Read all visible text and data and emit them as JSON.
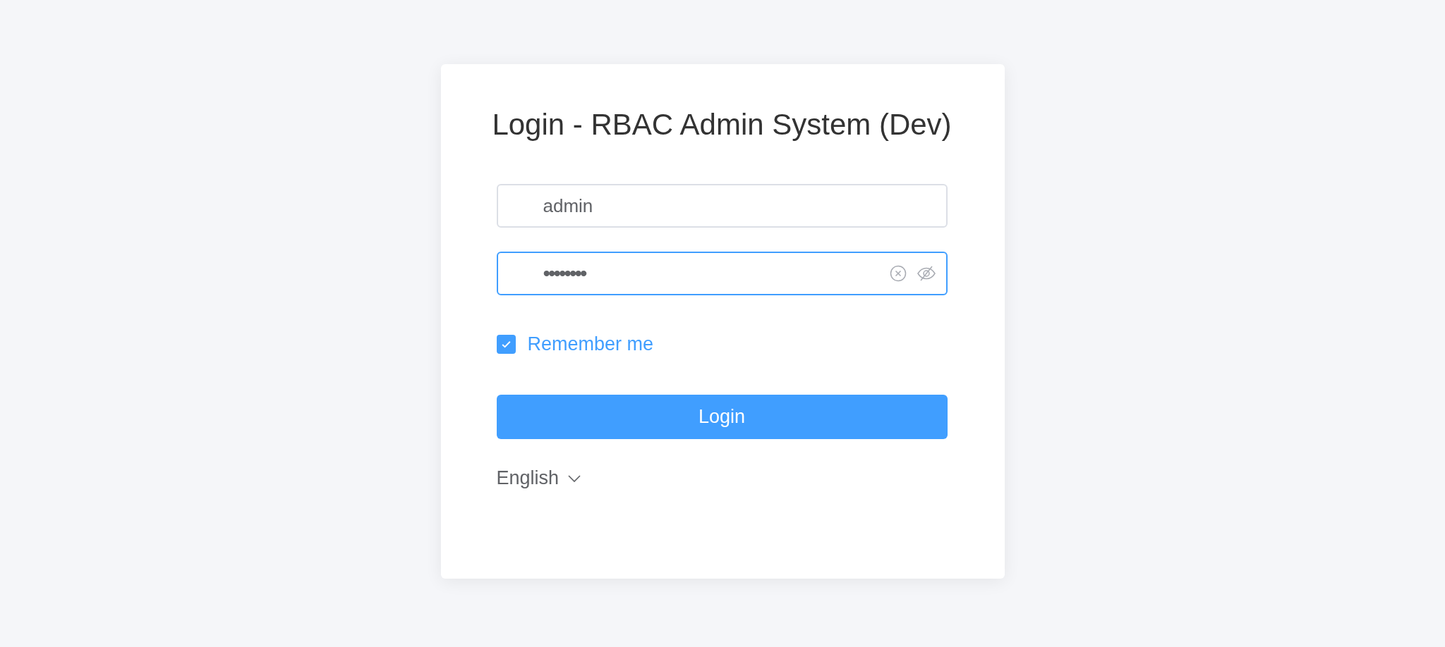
{
  "title": "Login - RBAC Admin System (Dev)",
  "fields": [
    {
      "kind": "text",
      "value": "admin",
      "focused": false
    },
    {
      "kind": "password",
      "value": "••••••••",
      "focused": true
    }
  ],
  "remember": {
    "label": "Remember me",
    "checked": true
  },
  "login_button": "Login",
  "language": "English"
}
